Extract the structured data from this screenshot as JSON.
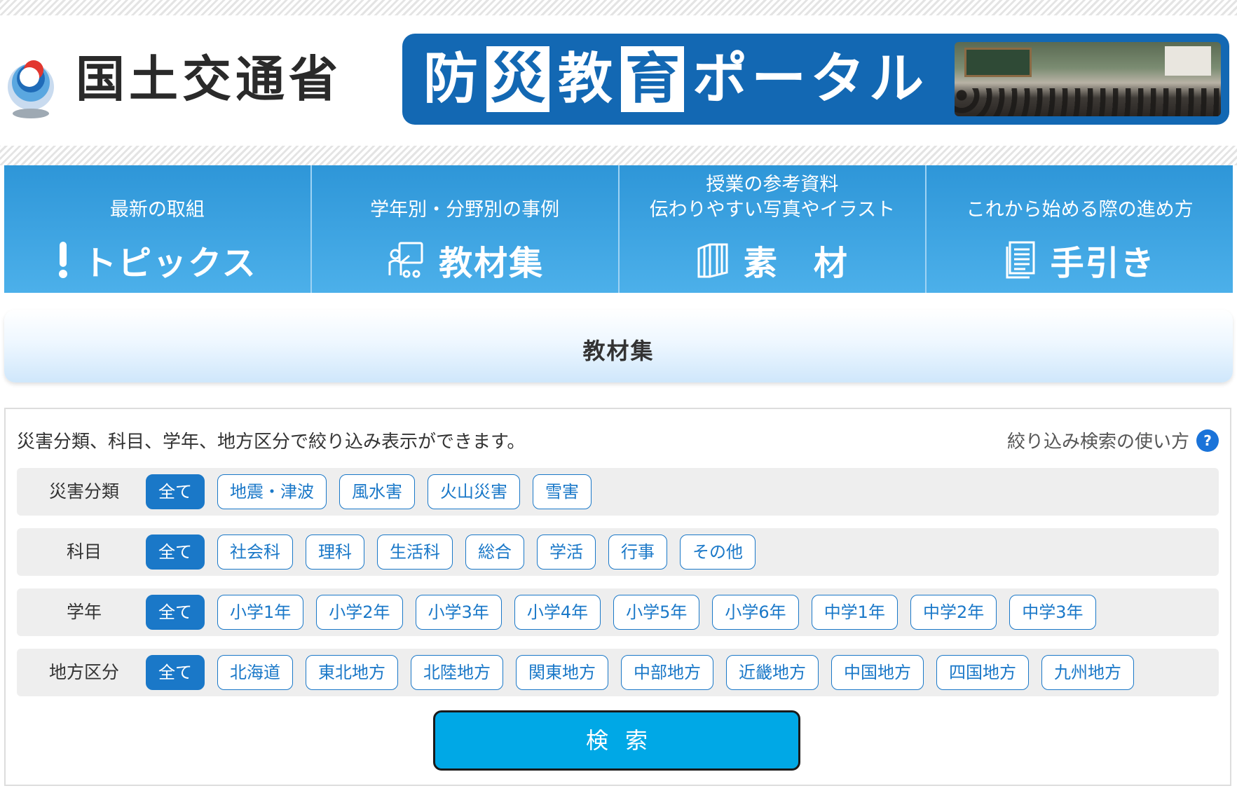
{
  "header": {
    "ministry_name": "国土交通省",
    "portal_title_chars": [
      "防",
      "災",
      "教",
      "育",
      "ポ",
      "ー",
      "タ",
      "ル"
    ]
  },
  "nav": {
    "items": [
      {
        "sub": "最新の取組",
        "label": "トピックス",
        "icon": "exclamation-icon"
      },
      {
        "sub": "学年別・分野別の事例",
        "label": "教材集",
        "icon": "teacher-icon"
      },
      {
        "sub_line1": "授業の参考資料",
        "sub_line2": "伝わりやすい写真やイラスト",
        "label": "素　材",
        "icon": "books-icon"
      },
      {
        "sub": "これから始める際の進め方",
        "label": "手引き",
        "icon": "document-icon"
      }
    ]
  },
  "section": {
    "title": "教材集"
  },
  "filter": {
    "description": "災害分類、科目、学年、地方区分で絞り込み表示ができます。",
    "help_label": "絞り込み検索の使い方",
    "help_icon_glyph": "?",
    "rows": [
      {
        "label": "災害分類",
        "options": [
          "全て",
          "地震・津波",
          "風水害",
          "火山災害",
          "雪害"
        ]
      },
      {
        "label": "科目",
        "options": [
          "全て",
          "社会科",
          "理科",
          "生活科",
          "総合",
          "学活",
          "行事",
          "その他"
        ]
      },
      {
        "label": "学年",
        "options": [
          "全て",
          "小学1年",
          "小学2年",
          "小学3年",
          "小学4年",
          "小学5年",
          "小学6年",
          "中学1年",
          "中学2年",
          "中学3年"
        ]
      },
      {
        "label": "地方区分",
        "options": [
          "全て",
          "北海道",
          "東北地方",
          "北陸地方",
          "関東地方",
          "中部地方",
          "近畿地方",
          "中国地方",
          "四国地方",
          "九州地方"
        ]
      }
    ],
    "search_label": "検索"
  },
  "colors": {
    "banner_blue": "#1368b3",
    "nav_blue": "#3ca4e1",
    "chip_blue": "#1a78c8",
    "search_blue": "#00a8e6"
  }
}
